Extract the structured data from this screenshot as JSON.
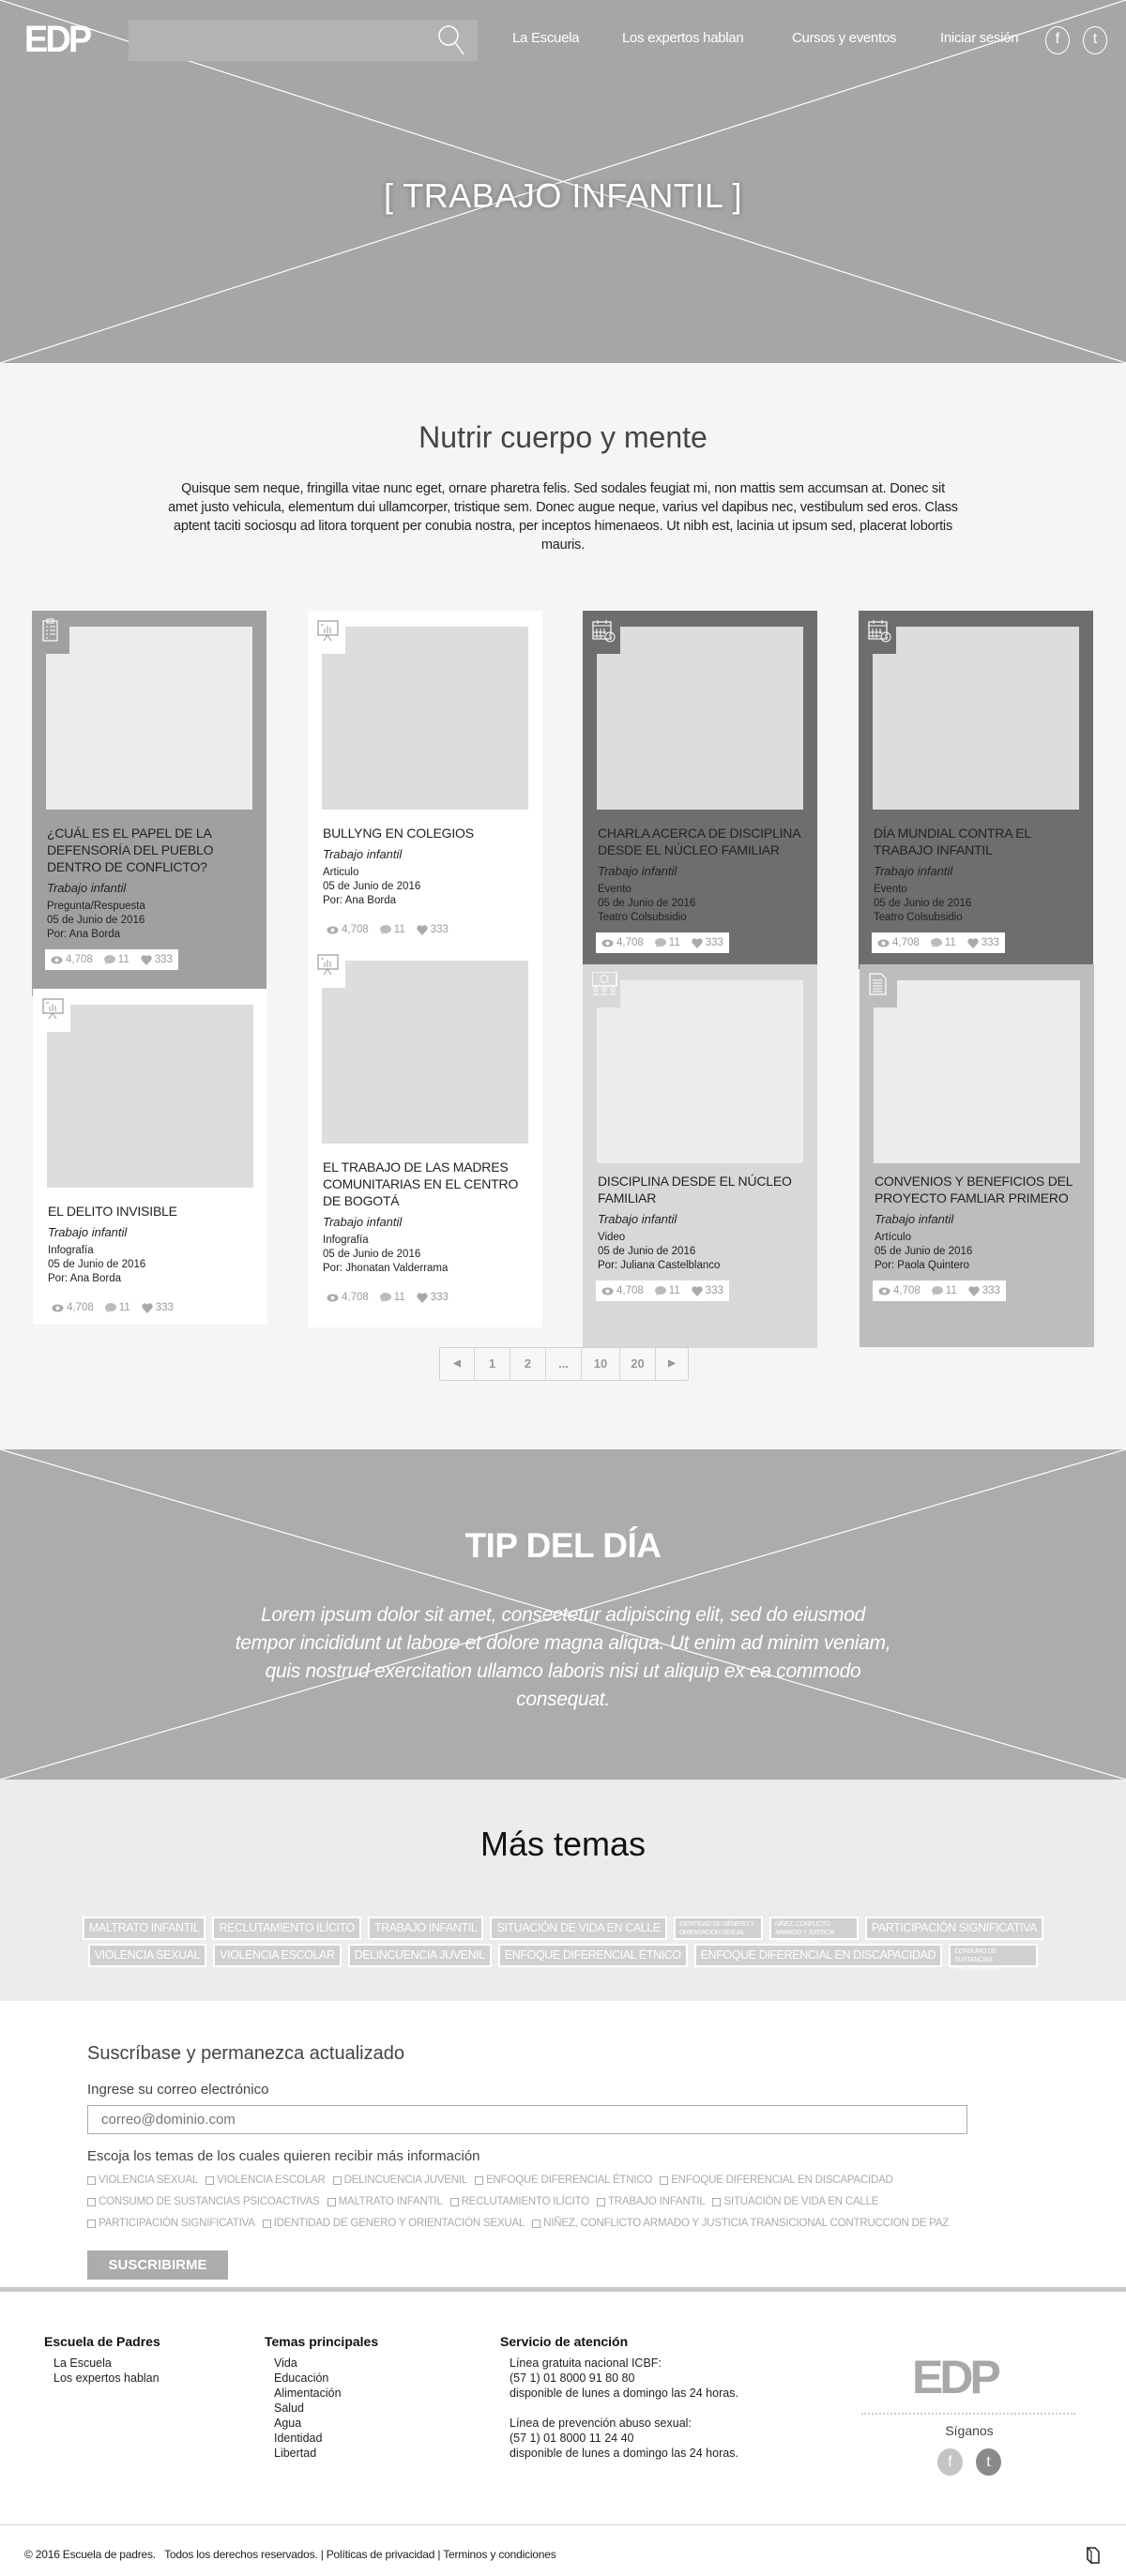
{
  "header": {
    "logo": "EDP",
    "search_placeholder": "",
    "nav": [
      "La Escuela",
      "Los expertos hablan",
      "Cursos y eventos",
      "Iniciar sesión"
    ],
    "social": [
      "f",
      "t"
    ]
  },
  "hero": {
    "title": "[ TRABAJO INFANTIL ]"
  },
  "section": {
    "title": "Nutrir cuerpo y mente",
    "description": "Quisque sem neque, fringilla vitae nunc eget, ornare pharetra felis. Sed sodales feugiat mi, non mattis sem accumsan at. Donec sit amet justo vehicula, elementum dui ullamcorper, tristique sem. Donec augue neque, varius vel dapibus nec, vestibulum sed eros. Class aptent taciti sociosqu ad litora torquent per conubia nostra, per inceptos himenaeos. Ut nibh est, lacinia ut ipsum sed, placerat lobortis mauris."
  },
  "cards": [
    {
      "icon": "clipboard-icon",
      "bg": "#a0a0a0",
      "img": "#ececec",
      "title": "¿Cuál es el papel de la Defensoría del Pueblo dentro de conflicto?",
      "category": "Trabajo infantil",
      "type": "Pregunta/Respuesta",
      "date": "05 de Junio de 2016",
      "by": "Por: Ana Borda",
      "views": "4,708",
      "comments": "11",
      "likes": "333"
    },
    {
      "icon": "presentation-chart-icon",
      "bg": "#ffffff",
      "img": "#dddddd",
      "title": "Bullyng en colegios",
      "category": "Trabajo infantil",
      "type": "Articulo",
      "date": "05 de Junio de 2016",
      "by": "Por: Ana Borda",
      "views": "4,708",
      "comments": "11",
      "likes": "333"
    },
    {
      "icon": "calendar-clock-icon",
      "bg": "#6e6e6e",
      "img": "#dddddd",
      "title": "Charla acerca de disciplina desde el núcleo familiar",
      "category": "Trabajo infantil",
      "type": "Evento",
      "date": "05 de Junio de 2016",
      "by": "Teatro Colsubsidio",
      "views": "4,708",
      "comments": "11",
      "likes": "333"
    },
    {
      "icon": "calendar-clock-icon",
      "bg": "#6e6e6e",
      "img": "#dddddd",
      "title": "Día mundial contra el trabajo infantil",
      "category": "Trabajo infantil",
      "type": "Evento",
      "date": "05 de Junio de 2016",
      "by": "Teatro Colsubsidio",
      "views": "4,708",
      "comments": "11",
      "likes": "333"
    },
    {
      "icon": "presentation-chart-icon",
      "bg": "#ffffff",
      "img": "#dddddd",
      "title": "El delito invisible",
      "category": "Trabajo infantil",
      "type": "Infografía",
      "date": "05 de Junio de 2016",
      "by": "Por: Ana Borda",
      "views": "4,708",
      "comments": "11",
      "likes": "333"
    },
    {
      "icon": "presentation-chart-icon",
      "bg": "#ffffff",
      "img": "#dddddd",
      "title": "El trabajo de las madres comunitarias en el centro de Bogotá",
      "category": "Trabajo infantil",
      "type": "Infografía",
      "date": "05 de Junio de 2016",
      "by": "Por: Jhonatan Valderrama",
      "views": "4,708",
      "comments": "11",
      "likes": "333"
    },
    {
      "icon": "video-icon",
      "bg": "#d8d8d8",
      "img": "#ececec",
      "title": "Disciplina desde el núcleo familiar",
      "category": "Trabajo infantil",
      "type": "Video",
      "date": "05 de Junio de 2016",
      "by": "Por: Juliana Castelblanco",
      "views": "4,708",
      "comments": "11",
      "likes": "333"
    },
    {
      "icon": "document-icon",
      "bg": "#bdbdbd",
      "img": "#ececec",
      "title": "Convenios y beneficios del proyecto famliar primero",
      "category": "Trabajo infantil",
      "type": "Artículo",
      "date": "05 de Junio de 2016",
      "by": "Por: Paola Quintero",
      "views": "4,708",
      "comments": "11",
      "likes": "333"
    }
  ],
  "pagination": {
    "prev": "◀",
    "pages": [
      "1",
      "2",
      "...",
      "10",
      "20"
    ],
    "next": "▶"
  },
  "tip": {
    "title": "TIP DEL DÍA",
    "text": "Lorem ipsum dolor sit amet, consectetur adipiscing elit, sed do eiusmod tempor incididunt ut labore et dolore magna aliqua. Ut enim ad minim veniam, quis nostrud exercitation ullamco laboris nisi ut aliquip ex ea commodo consequat."
  },
  "topics": {
    "title": "Más temas",
    "rows": [
      [
        {
          "label": "MALTRATO INFANTIL"
        },
        {
          "label": "RECLUTAMIENTO ILÍCITO"
        },
        {
          "label": "TRABAJO INFANTIL"
        },
        {
          "label": "SITUACIÓN DE VIDA EN CALLE"
        },
        {
          "label": "IDENTIDAD DE GÉNERO Y ORIENTACIÓN SEXUAL",
          "small": true
        },
        {
          "label": "NIÑEZ, CONFLICTO ARMADO Y JUSTICIA TRANSICIONAL CONTRUCCION DE PAZ",
          "small": true
        },
        {
          "label": "PARTICIPACIÓN SIGNIFICATIVA"
        }
      ],
      [
        {
          "label": "VIOLENCIA SEXUAL"
        },
        {
          "label": "VIOLENCIA ESCOLAR"
        },
        {
          "label": "DELINCUENCIA JUVENIL"
        },
        {
          "label": "ENFOQUE DIFERENCIAL ÉTNICO"
        },
        {
          "label": "ENFOQUE DIFERENCIAL EN DISCAPACIDAD"
        },
        {
          "label": "CONSUMO DE SUSTANCIAS PSICOACTIVAS",
          "small": true
        }
      ]
    ]
  },
  "subscribe": {
    "title": "Suscríbase y permanezca actualizado",
    "email_label": "Ingrese su correo electrónico",
    "email_placeholder": "correo@dominio.com",
    "email_value": "",
    "topics_label": "Escoja los temas de los cuales quieren recibir más información",
    "checkbox_rows": [
      [
        "VIOLENCIA SEXUAL",
        "VIOLENCIA ESCOLAR",
        "DELINCUENCIA JUVENIL",
        "ENFOQUE DIFERENCIAL ÉTNICO",
        "ENFOQUE DIFERENCIAL EN DISCAPACIDAD"
      ],
      [
        "CONSUMO DE SUSTANCIAS PSICOACTIVAS",
        "MALTRATO INFANTIL",
        "RECLUTAMIENTO ILÍCITO",
        "TRABAJO INFANTIL",
        "SITUACIÓN DE VIDA EN CALLE"
      ],
      [
        "PARTICIPACIÓN SIGNIFICATIVA",
        "IDENTIDAD DE GENERO Y ORIENTACIÓN SEXUAL",
        "NIÑEZ, CONFLICTO ARMADO Y JUSTICIA TRANSICIONAL CONTRUCCION DE PAZ"
      ]
    ],
    "button": "SUSCRIBIRME"
  },
  "footer": {
    "col1": {
      "title": "Escuela de Padres",
      "links": [
        "La Escuela",
        "Los expertos hablan"
      ]
    },
    "col2": {
      "title": "Temas principales",
      "links": [
        "Vida",
        "Educación",
        "Alimentación",
        "Salud",
        "Agua",
        "Identidad",
        "Libertad"
      ]
    },
    "col3": {
      "title": "Servicio de atención",
      "lines": [
        "Línea gratuita nacional ICBF:",
        "(57 1) 01 8000 91 80 80",
        "disponible de lunes a domingo las 24 horas.",
        "",
        "Línea de prevención abuso sexual:",
        "(57 1) 01 8000 11 24 40",
        "disponible de lunes a domingo las 24 horas."
      ]
    },
    "logo": "EDP",
    "follow": "Síganos",
    "social": [
      "f",
      "t"
    ],
    "copyright": "© 2016 Escuela de padres.   Todos los derechos reservados.",
    "privacy": "Políticas de privacidad",
    "terms": "Terminos y condiciones",
    "separator": "|"
  }
}
